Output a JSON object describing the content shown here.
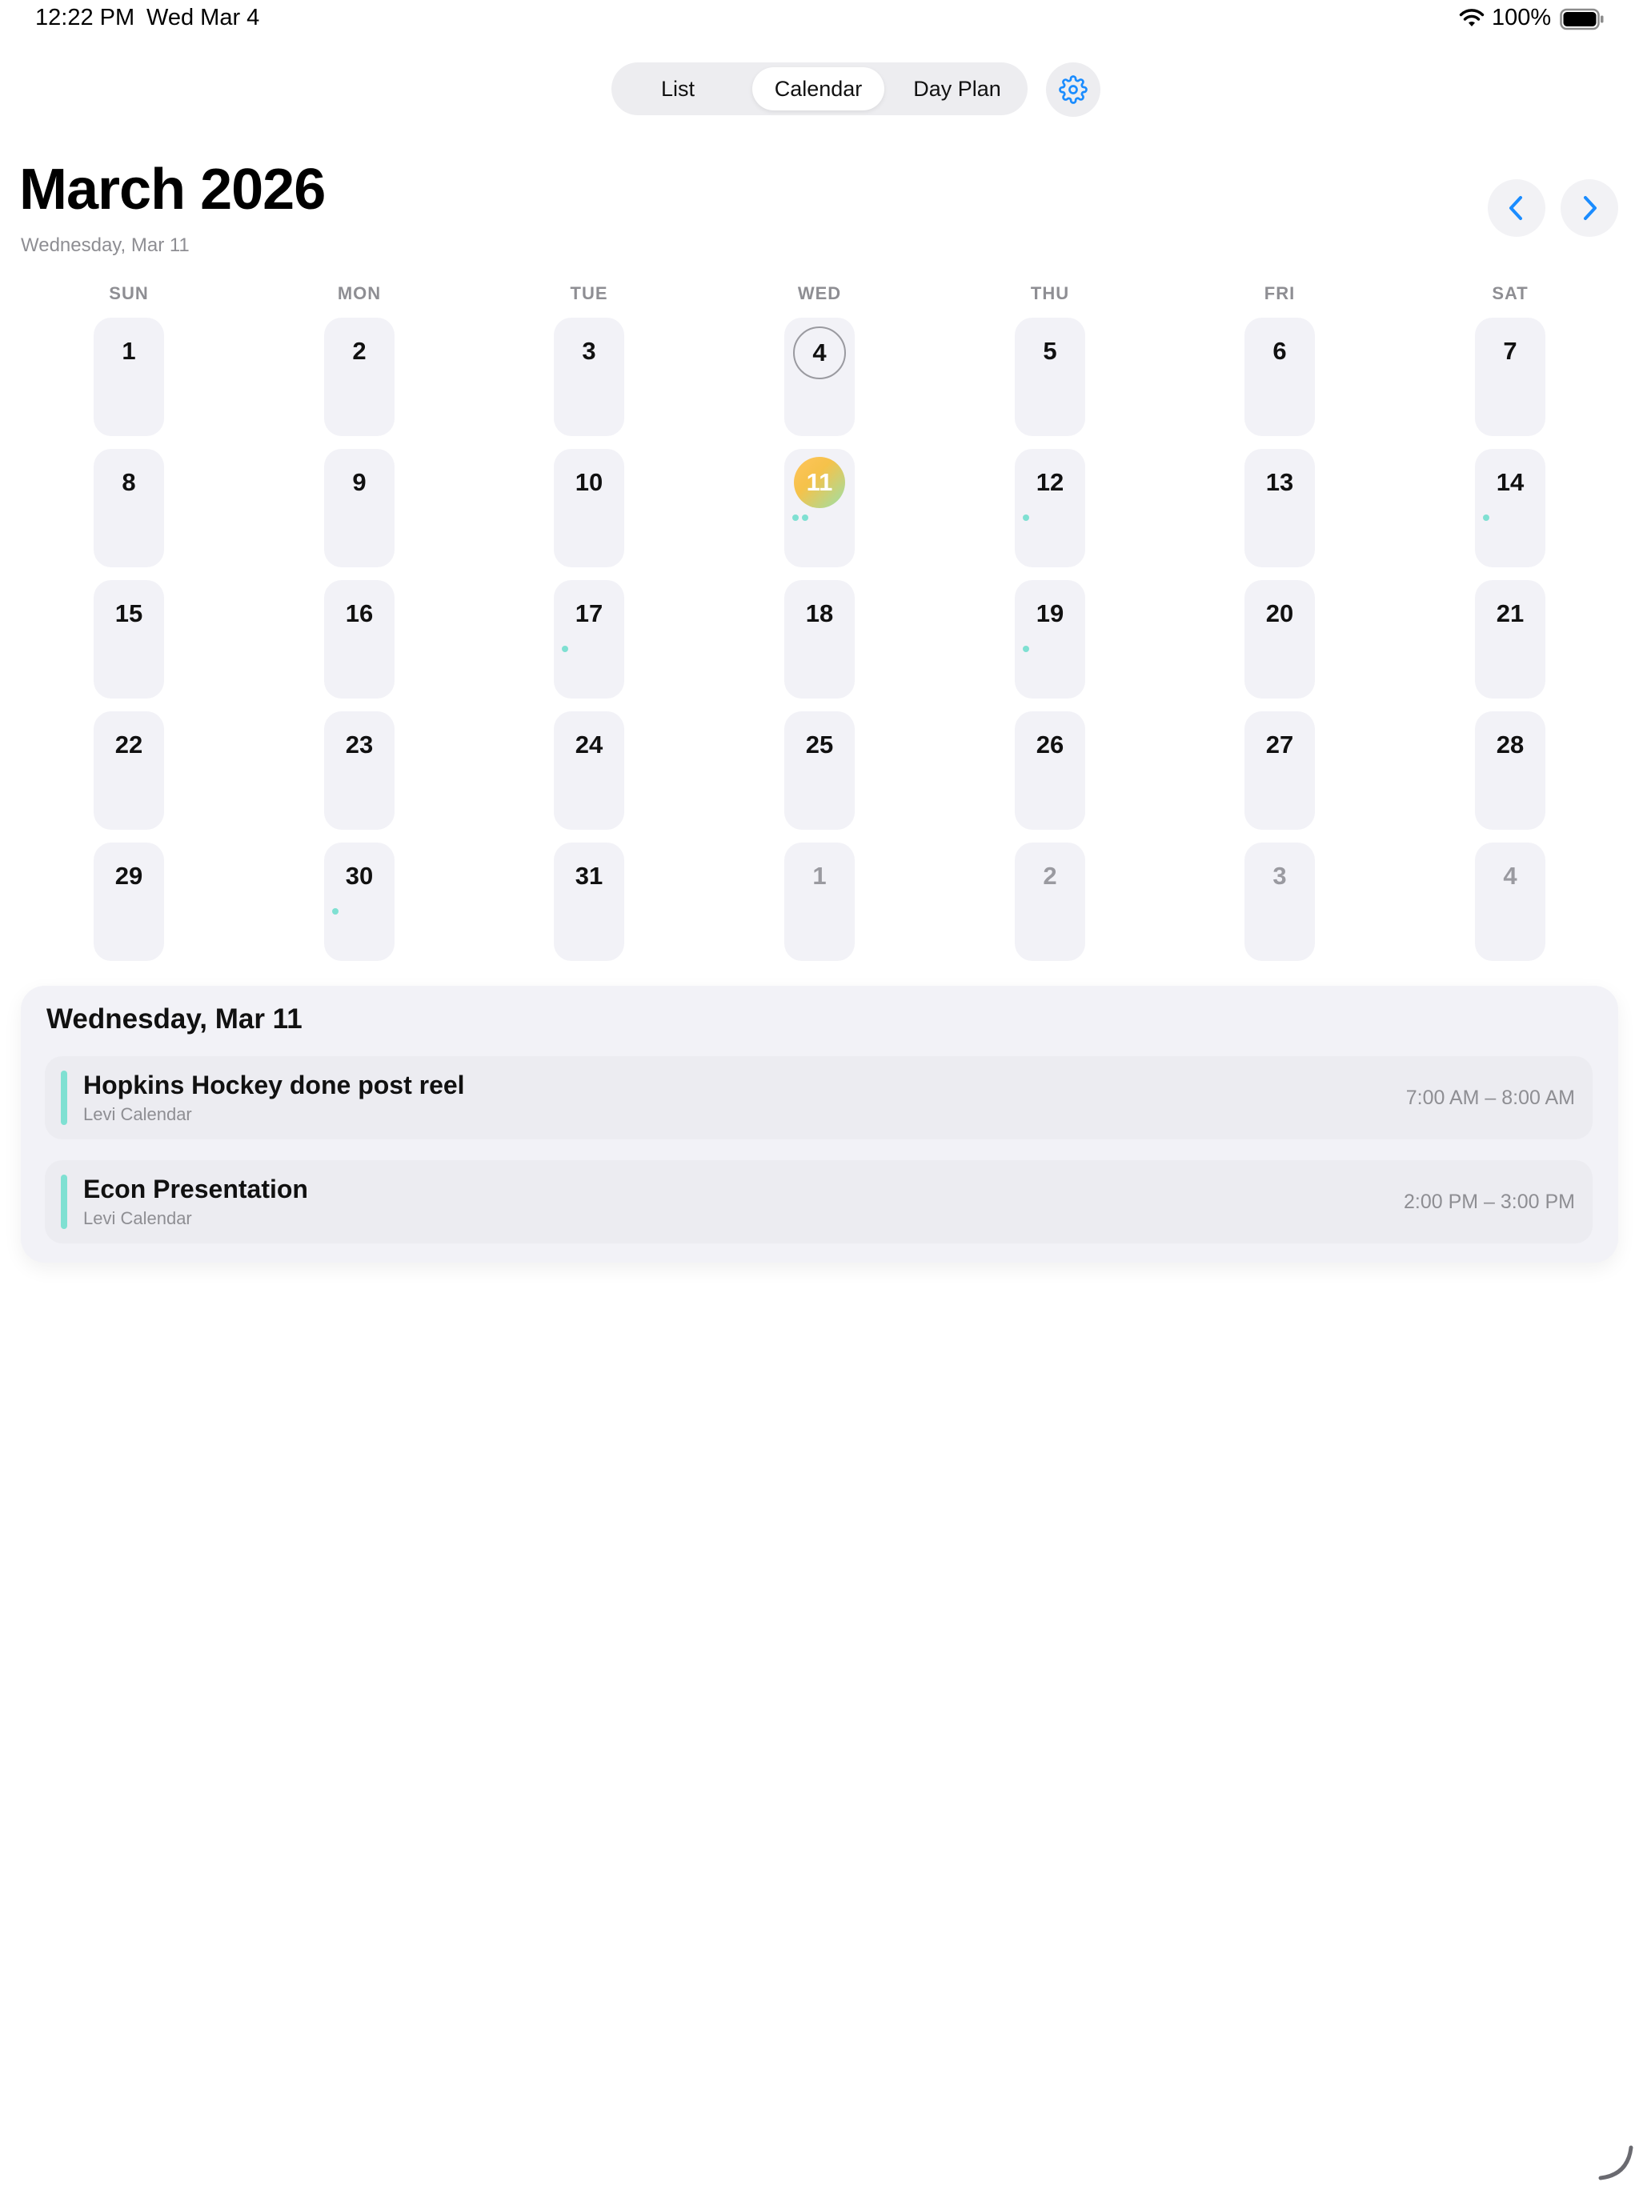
{
  "status_bar": {
    "time": "12:22 PM",
    "date": "Wed Mar 4",
    "battery": "100%",
    "icons": [
      "wifi-icon",
      "battery-icon"
    ]
  },
  "segmented": {
    "items": [
      {
        "label": "List",
        "active": false
      },
      {
        "label": "Calendar",
        "active": true
      },
      {
        "label": "Day Plan",
        "active": false
      }
    ]
  },
  "header": {
    "month_title": "March 2026",
    "selected_date": "Wednesday, Mar 11"
  },
  "calendar": {
    "weekdays": [
      "SUN",
      "MON",
      "TUE",
      "WED",
      "THU",
      "FRI",
      "SAT"
    ],
    "today": 4,
    "selected": 11,
    "weeks": [
      [
        {
          "n": "1"
        },
        {
          "n": "2"
        },
        {
          "n": "3"
        },
        {
          "n": "4",
          "today": true
        },
        {
          "n": "5"
        },
        {
          "n": "6"
        },
        {
          "n": "7"
        }
      ],
      [
        {
          "n": "8"
        },
        {
          "n": "9"
        },
        {
          "n": "10"
        },
        {
          "n": "11",
          "selected": true,
          "dots": 2
        },
        {
          "n": "12",
          "dots": 1
        },
        {
          "n": "13"
        },
        {
          "n": "14",
          "dots": 1
        }
      ],
      [
        {
          "n": "15"
        },
        {
          "n": "16"
        },
        {
          "n": "17",
          "dots": 1
        },
        {
          "n": "18"
        },
        {
          "n": "19",
          "dots": 1
        },
        {
          "n": "20"
        },
        {
          "n": "21"
        }
      ],
      [
        {
          "n": "22"
        },
        {
          "n": "23"
        },
        {
          "n": "24"
        },
        {
          "n": "25"
        },
        {
          "n": "26"
        },
        {
          "n": "27"
        },
        {
          "n": "28"
        }
      ],
      [
        {
          "n": "29"
        },
        {
          "n": "30",
          "dots": 1
        },
        {
          "n": "31"
        },
        {
          "n": "1",
          "other": true
        },
        {
          "n": "2",
          "other": true
        },
        {
          "n": "3",
          "other": true
        },
        {
          "n": "4",
          "other": true
        }
      ]
    ],
    "event_dot_color": "#7fe0d2"
  },
  "events": {
    "title": "Wednesday, Mar 11",
    "items": [
      {
        "title": "Hopkins Hockey done post reel",
        "calendar": "Levi Calendar",
        "time": "7:00 AM – 8:00 AM",
        "color": "#7fe0d2"
      },
      {
        "title": "Econ Presentation",
        "calendar": "Levi Calendar",
        "time": "2:00 PM – 3:00 PM",
        "color": "#7fe0d2"
      }
    ]
  },
  "colors": {
    "accent": "#1a8cff",
    "cell_bg": "#f2f2f7",
    "muted_text": "#8e8e93"
  }
}
